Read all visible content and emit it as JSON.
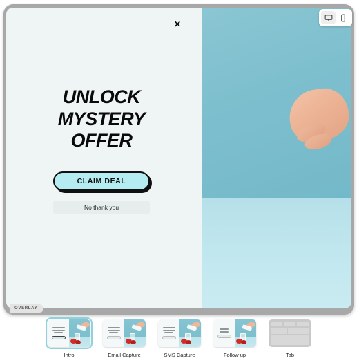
{
  "editor": {
    "frame_label": "OVERLAY",
    "close_label": "✕",
    "device_toggle": {
      "desktop": {
        "icon": "desktop-monitor-icon",
        "label": "Desktop",
        "active": true
      },
      "mobile": {
        "icon": "mobile-phone-icon",
        "label": "Mobile",
        "active": false
      }
    }
  },
  "overlay": {
    "headline_line1": "UNLOCK",
    "headline_line2": "MYSTERY",
    "headline_line3": "OFFER",
    "primary_button": "CLAIM DEAL",
    "secondary_button": "No thank you",
    "image_alt": "Hand pouring milk from a bottle into a glass beside strawberries"
  },
  "colors": {
    "bezel": "#a8a8a8",
    "panel_bg": "#eef5f4",
    "primary_button_fill": "#b4ecf1",
    "primary_button_border": "#111111",
    "secondary_button_fill": "#e7eded",
    "photo_wall": "#7cbfce",
    "photo_table": "#bce4eb",
    "selection_outline": "#8fd2de",
    "thumb_blank": "#c9c9c9"
  },
  "steps": [
    {
      "label": "Intro",
      "type": "overlay",
      "selected": true
    },
    {
      "label": "Email Capture",
      "type": "overlay",
      "selected": false
    },
    {
      "label": "SMS Capture",
      "type": "overlay",
      "selected": false
    },
    {
      "label": "Follow up",
      "type": "overlay",
      "selected": false
    },
    {
      "label": "Tab",
      "type": "blank",
      "selected": false
    }
  ]
}
